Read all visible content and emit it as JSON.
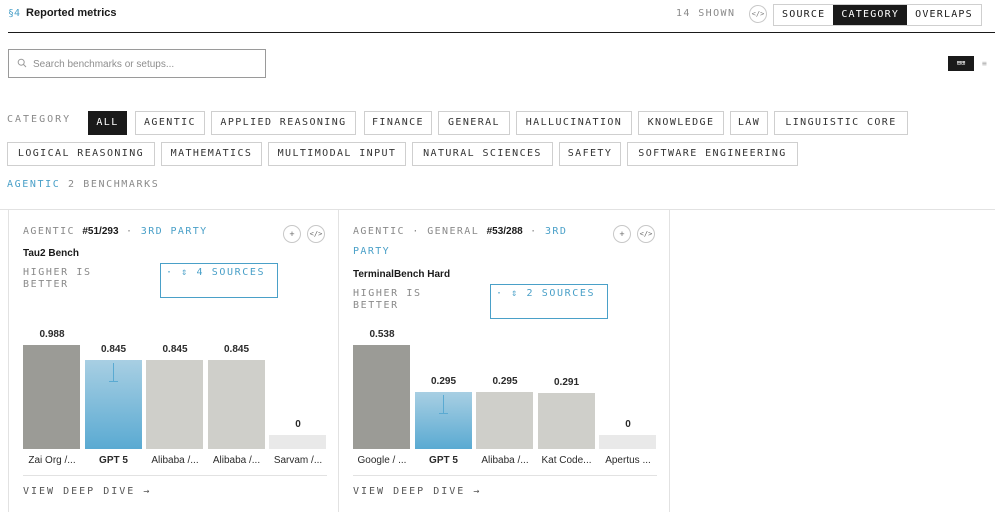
{
  "header": {
    "section": "§4",
    "title": "Reported metrics",
    "shown": "14 SHOWN",
    "code_icon": "code-icon",
    "view_modes": [
      "SOURCE",
      "CATEGORY",
      "OVERLAPS"
    ],
    "active_view_mode": "CATEGORY"
  },
  "search": {
    "placeholder": "Search benchmarks or setups..."
  },
  "layout_toggle": {
    "grid_label": "⊞⊞",
    "list_label": "≡"
  },
  "categories": {
    "label": "CATEGORY",
    "items": [
      "ALL",
      "AGENTIC",
      "APPLIED REASONING",
      "FINANCE",
      "GENERAL",
      "HALLUCINATION",
      "KNOWLEDGE",
      "LAW",
      "LINGUISTIC CORE",
      "LOGICAL REASONING",
      "MATHEMATICS",
      "MULTIMODAL INPUT",
      "NATURAL SCIENCES",
      "SAFETY",
      "SOFTWARE ENGINEERING"
    ],
    "active": "ALL"
  },
  "group": {
    "name": "AGENTIC",
    "count": "2 BENCHMARKS"
  },
  "colors": {
    "accent": "#4aa0c8",
    "top_bar": "#9b9b96",
    "highlight_bar_top": "#a8cfe3",
    "highlight_bar_bottom": "#5aaad2",
    "other_bar": "#cfcfca",
    "zero_bar": "#e9e9e9",
    "dark": "#1a1a1a"
  },
  "cards": [
    {
      "categories": "AGENTIC",
      "rank": "#51/293",
      "separator": " · ",
      "third_party": "3RD PARTY",
      "title": "Tau2 Bench",
      "direction": "HIGHER IS BETTER",
      "sources": "· ⇕ 4 SOURCES",
      "deep_dive": "VIEW DEEP DIVE →",
      "chart_data": {
        "type": "bar",
        "categories": [
          "Zai Org /...",
          "GPT 5",
          "Alibaba /...",
          "Alibaba /...",
          "Sarvam /..."
        ],
        "values": [
          0.988,
          0.845,
          0.845,
          0.845,
          0
        ],
        "value_labels": [
          "0.988",
          "0.845",
          "0.845",
          "0.845",
          "0"
        ],
        "highlight_index": 1,
        "ylim": [
          0,
          0.988
        ],
        "error_bar_on_highlight": true
      }
    },
    {
      "categories": "AGENTIC · GENERAL",
      "rank": "#53/288",
      "separator": " · ",
      "third_party": "3RD PARTY",
      "title": "TerminalBench Hard",
      "direction": "HIGHER IS BETTER",
      "sources": "· ⇕ 2 SOURCES",
      "deep_dive": "VIEW DEEP DIVE →",
      "chart_data": {
        "type": "bar",
        "categories": [
          "Google / ...",
          "GPT 5",
          "Alibaba /...",
          "Kat Code...",
          "Apertus ..."
        ],
        "values": [
          0.538,
          0.295,
          0.295,
          0.291,
          0
        ],
        "value_labels": [
          "0.538",
          "0.295",
          "0.295",
          "0.291",
          "0"
        ],
        "highlight_index": 1,
        "ylim": [
          0,
          0.538
        ],
        "error_bar_on_highlight": true
      }
    }
  ]
}
